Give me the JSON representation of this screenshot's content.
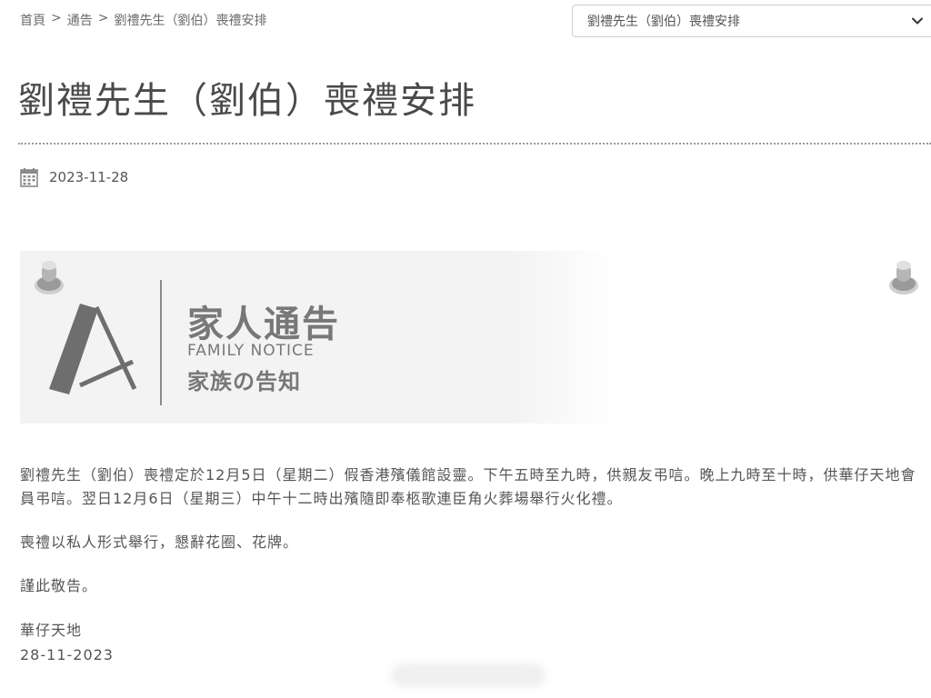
{
  "breadcrumb": {
    "home": "首頁",
    "sep1": ">",
    "section": "通告",
    "sep2": ">",
    "current": "劉禮先生（劉伯）喪禮安排"
  },
  "selector": {
    "selected": "劉禮先生（劉伯）喪禮安排"
  },
  "page_title": "劉禮先生（劉伯）喪禮安排",
  "date": "2023-11-28",
  "notice_image": {
    "title_cn": "家人通告",
    "title_en": "FAMILY NOTICE",
    "title_jp": "家族の告知"
  },
  "content": {
    "paragraph1": "劉禮先生（劉伯）喪禮定於12月5日（星期二）假香港殯儀館設靈。下午五時至九時，供親友弔唁。晚上九時至十時，供華仔天地會員弔唁。翌日12月6日（星期三）中午十二時出殯隨即奉柩歌連臣角火葬場舉行火化禮。",
    "paragraph2": "喪禮以私人形式舉行，懇辭花圈、花牌。",
    "paragraph3": "謹此敬告。",
    "signature": "華仔天地",
    "signature_date": "28-11-2023"
  },
  "icons": {
    "calendar": "calendar-icon",
    "chevron": "chevron-down-icon",
    "pin": "pushpin-icon"
  },
  "colors": {
    "text": "#555555",
    "title": "#4a4a4a",
    "notice_bg": "#f3f3f3",
    "notice_text": "#787878"
  }
}
